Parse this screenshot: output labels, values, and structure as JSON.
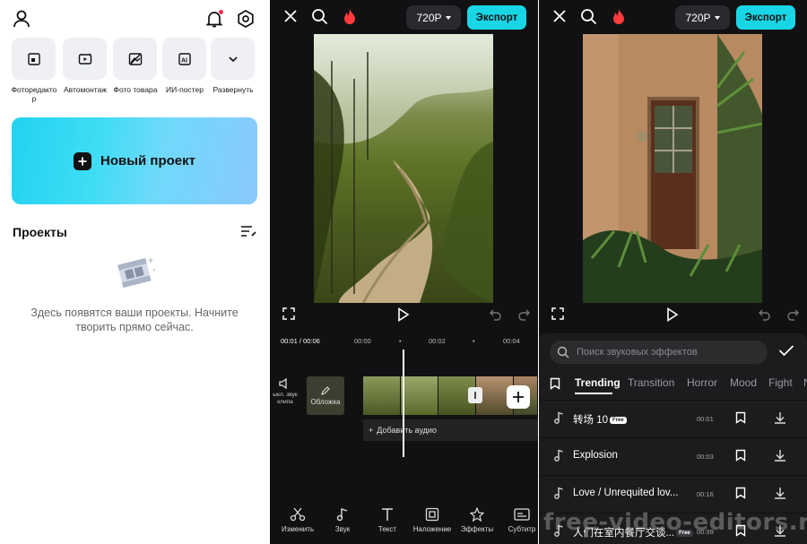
{
  "home": {
    "tools": [
      {
        "label": "Фоторедакто\nр",
        "icon": "photo-edit-icon"
      },
      {
        "label": "Автомонтаж",
        "icon": "auto-edit-icon"
      },
      {
        "label": "Фото товара",
        "icon": "product-photo-icon"
      },
      {
        "label": "ИИ-постер",
        "icon": "ai-poster-icon"
      },
      {
        "label": "Развернуть",
        "icon": "chevron-down-icon"
      }
    ],
    "new_project_label": "Новый проект",
    "projects_title": "Проекты",
    "empty_text": "Здесь появятся ваши проекты. Начните творить прямо сейчас."
  },
  "editor": {
    "resolution": "720P",
    "export_label": "Экспорт",
    "timeline": {
      "current": "00:01",
      "total": "/ 00:06",
      "ticks": [
        "00:00",
        "00:02",
        "00:04"
      ]
    },
    "mute_label": "ыкл. звук клипа",
    "cover_label": "Обложка",
    "add_audio_label": "Добавить аудио",
    "bottom_tools": [
      "Изменить",
      "Звук",
      "Текст",
      "Наложение",
      "Эффекты",
      "Субтитр"
    ]
  },
  "sfx": {
    "search_placeholder": "Поиск звуковых эффектов",
    "categories": [
      "Trending",
      "Transition",
      "Horror",
      "Mood",
      "Fight",
      "N"
    ],
    "active_category": "Trending",
    "items": [
      {
        "name": "转场 10",
        "duration": "00:01",
        "badge": "Free"
      },
      {
        "name": "Explosion",
        "duration": "00:03",
        "badge": ""
      },
      {
        "name": "Love / Unrequited lov...",
        "duration": "00:16",
        "badge": ""
      },
      {
        "name": "人们在室内餐厅交谈...",
        "duration": "00:39",
        "badge": "Free"
      }
    ]
  },
  "watermark": "free-video-editors.ru",
  "colors": {
    "accent": "#19d6e6",
    "dark_bg": "#111113"
  }
}
